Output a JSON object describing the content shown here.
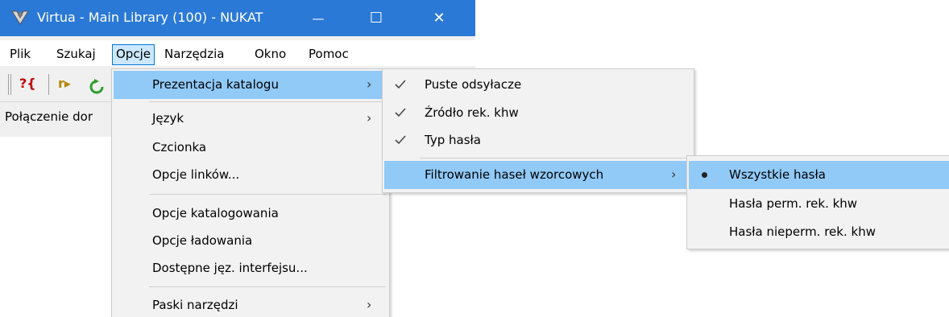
{
  "window": {
    "title": "Virtua - Main Library (100) - NUKAT",
    "minimize_glyph": "—",
    "maximize_glyph": "☐",
    "close_glyph": "✕"
  },
  "menubar": {
    "items": [
      "Plik",
      "Szukaj",
      "Opcje",
      "Narzędzia",
      "Okno",
      "Pomoc"
    ]
  },
  "toolbar": {
    "icon1_text": "?{",
    "icon2_text": "r▸"
  },
  "status": {
    "text": "Połączenie dor"
  },
  "opcje_menu": {
    "items": [
      {
        "label": "Prezentacja katalogu",
        "submenu": true
      },
      {
        "label": "Język",
        "submenu": true
      },
      {
        "label": "Czcionka",
        "submenu": false
      },
      {
        "label": "Opcje linków...",
        "submenu": false
      },
      {
        "label": "Opcje katalogowania",
        "submenu": false
      },
      {
        "label": "Opcje ładowania",
        "submenu": false
      },
      {
        "label": "Dostępne jęz. interfejsu...",
        "submenu": false
      },
      {
        "label": "Paski narzędzi",
        "submenu": true
      }
    ],
    "arrow": "›"
  },
  "prezentacja_menu": {
    "items": [
      {
        "label": "Puste odsyłacze",
        "checked": true
      },
      {
        "label": "Źródło rek. khw",
        "checked": true
      },
      {
        "label": "Typ hasła",
        "checked": true
      },
      {
        "label": "Filtrowanie haseł wzorcowych",
        "submenu": true
      }
    ],
    "arrow": "›"
  },
  "filtrowanie_menu": {
    "items": [
      {
        "label": "Wszystkie hasła",
        "selected": true
      },
      {
        "label": "Hasła perm. rek. khw",
        "selected": false
      },
      {
        "label": "Hasła nieperm. rek. khw",
        "selected": false
      }
    ]
  },
  "colors": {
    "titlebar": "#2b79d6",
    "menu_highlight": "#91c9f7",
    "menu_open": "#cce8ff",
    "menu_background": "#f2f2f2"
  },
  "icons": [
    "virtua-app-icon",
    "check-icon",
    "radio-bullet-icon",
    "submenu-arrow-icon",
    "minimize-icon",
    "maximize-icon",
    "close-icon"
  ]
}
